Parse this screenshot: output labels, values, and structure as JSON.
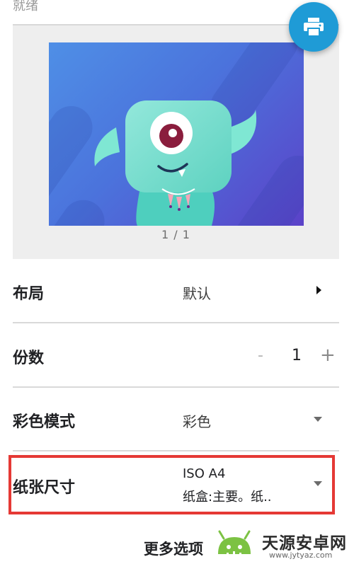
{
  "status": {
    "text": "就绪"
  },
  "preview": {
    "page_indicator": "1 / 1"
  },
  "fab": {
    "icon": "print-icon",
    "color": "#1f9bd6"
  },
  "settings": {
    "layout": {
      "label": "布局",
      "value": "默认",
      "icon": "arrow-right-icon"
    },
    "copies": {
      "label": "份数",
      "minus": "-",
      "value": "1",
      "plus": "+"
    },
    "color_mode": {
      "label": "彩色模式",
      "value": "彩色",
      "icon": "dropdown-icon"
    },
    "paper_size": {
      "label": "纸张尺寸",
      "value_line1": "ISO A4",
      "value_line2": "纸盒:主要。纸..",
      "icon": "dropdown-icon"
    }
  },
  "more_options": {
    "label": "更多选项"
  },
  "highlight": {
    "color": "#e53935"
  },
  "watermark": {
    "text": "天源安卓网",
    "url": "www.jytyaz.com"
  }
}
